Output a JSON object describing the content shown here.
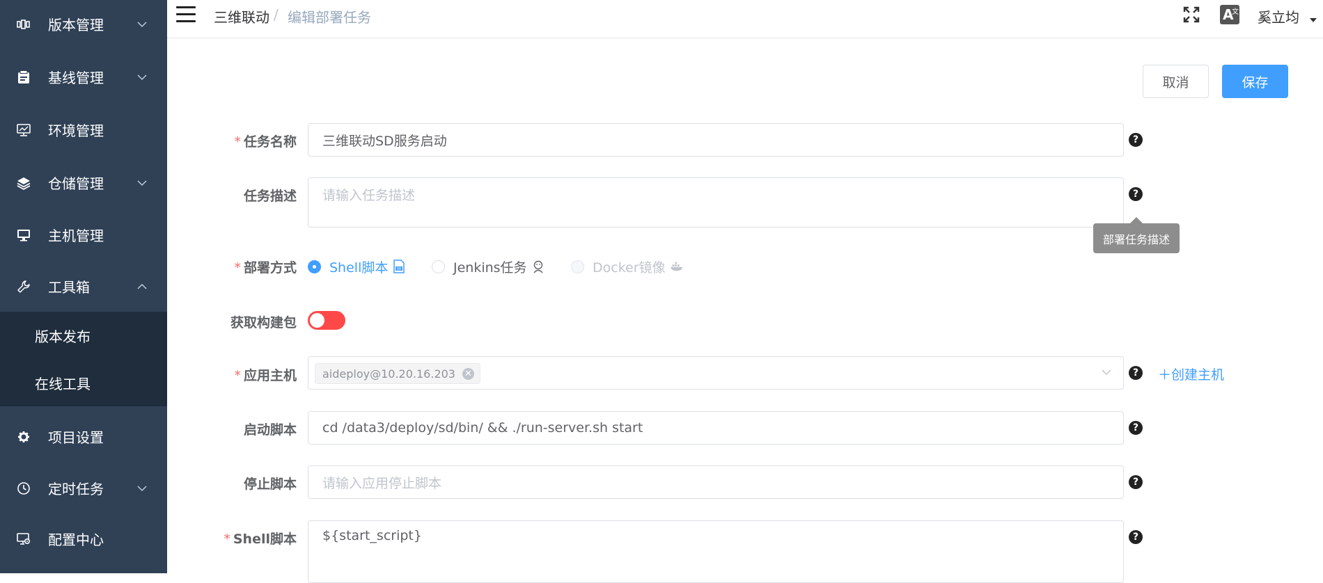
{
  "sidebar": {
    "items": [
      {
        "label": "版本管理",
        "icon": "version-icon",
        "expandable": true,
        "expanded": false
      },
      {
        "label": "基线管理",
        "icon": "baseline-icon",
        "expandable": true,
        "expanded": false
      },
      {
        "label": "环境管理",
        "icon": "monitor-chart-icon",
        "expandable": false
      },
      {
        "label": "仓储管理",
        "icon": "layers-icon",
        "expandable": true,
        "expanded": false
      },
      {
        "label": "主机管理",
        "icon": "desktop-icon",
        "expandable": false
      },
      {
        "label": "工具箱",
        "icon": "wrench-icon",
        "expandable": true,
        "expanded": true
      },
      {
        "label": "项目设置",
        "icon": "gear-icon",
        "expandable": false
      },
      {
        "label": "定时任务",
        "icon": "clock-icon",
        "expandable": true,
        "expanded": false
      },
      {
        "label": "配置中心",
        "icon": "config-icon",
        "expandable": false
      }
    ],
    "submenu": [
      {
        "label": "版本发布"
      },
      {
        "label": "在线工具"
      }
    ]
  },
  "navbar": {
    "breadcrumb": [
      "三维联动",
      "编辑部署任务"
    ],
    "separator": "/",
    "user": "奚立均",
    "lang_icon": "translate-icon",
    "lang_text": "A",
    "lang_small": "文"
  },
  "actions": {
    "cancel": "取消",
    "save": "保存"
  },
  "form": {
    "task_name": {
      "label": "任务名称",
      "required": true,
      "value": "三维联动SD服务启动"
    },
    "task_desc": {
      "label": "任务描述",
      "required": false,
      "placeholder": "请输入任务描述",
      "tooltip": "部署任务描述"
    },
    "deploy_mode": {
      "label": "部署方式",
      "required": true,
      "options": [
        {
          "label": "Shell脚本",
          "checked": true,
          "disabled": false,
          "icon": "shell-icon"
        },
        {
          "label": "Jenkins任务",
          "checked": false,
          "disabled": false,
          "icon": "jenkins-icon"
        },
        {
          "label": "Docker镜像",
          "checked": false,
          "disabled": true,
          "icon": "docker-icon"
        }
      ]
    },
    "fetch_package": {
      "label": "获取构建包",
      "enabled": false
    },
    "host": {
      "label": "应用主机",
      "required": true,
      "tag": "aideploy@10.20.16.203",
      "create_link": "＋创建主机"
    },
    "start_script": {
      "label": "启动脚本",
      "required": false,
      "value": "cd /data3/deploy/sd/bin/ && ./run-server.sh start"
    },
    "stop_script": {
      "label": "停止脚本",
      "required": false,
      "placeholder": "请输入应用停止脚本"
    },
    "shell_script": {
      "label": "Shell脚本",
      "required": true,
      "value": "${start_script}"
    }
  },
  "colors": {
    "sidebar_bg": "#304156",
    "submenu_bg": "#1f2d3d",
    "primary": "#409eff",
    "danger": "#ff4949",
    "required": "#f56c6c"
  }
}
